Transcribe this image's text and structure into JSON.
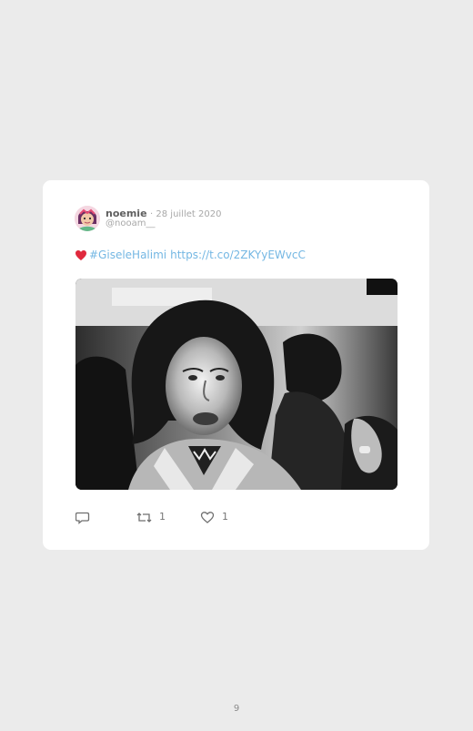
{
  "tweet": {
    "author_name": "noemie",
    "date": "28 juillet 2020",
    "handle": "@nooam__",
    "hashtag": "#GiseleHalimi",
    "link": "https://t.co/2ZKYyEWvcC",
    "emoji": "heart-emoji",
    "retweet_count": "1",
    "like_count": "1"
  },
  "icons": {
    "reply": "comment-icon",
    "retweet": "retweet-icon",
    "like": "heart-outline-icon"
  },
  "colors": {
    "link": "#74b7e3",
    "emoji_heart": "#e0293d",
    "card_background": "#ffffff",
    "page_background": "#ebebeb"
  },
  "page": {
    "number": "9"
  }
}
